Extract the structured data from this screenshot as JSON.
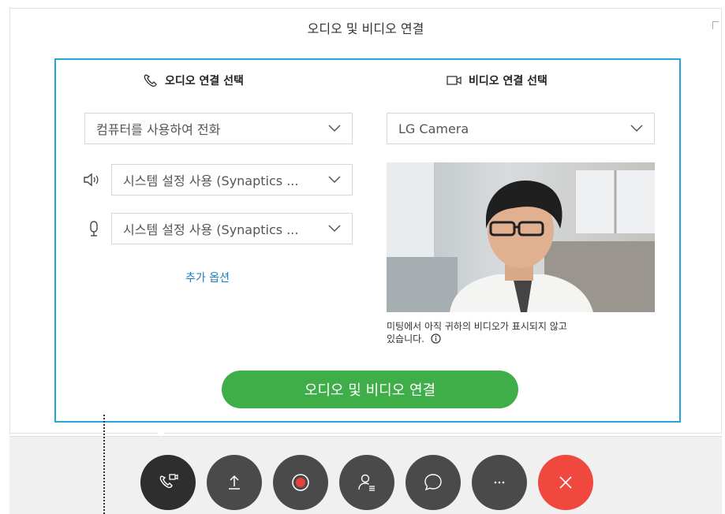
{
  "dialog": {
    "title": "오디오 및 비디오 연결"
  },
  "audio": {
    "heading": "오디오 연결 선택",
    "source": "컴퓨터를 사용하여 전화",
    "speaker": "시스템 설정 사용 (Synaptics ...",
    "microphone": "시스템 설정 사용 (Synaptics ...",
    "more_options": "추가 옵션"
  },
  "video": {
    "heading": "비디오 연결 선택",
    "camera": "LG Camera",
    "note_line1": "미팅에서 아직 귀하의 비디오가 표시되지 않고",
    "note_line2": "있습니다."
  },
  "connect_button": "오디오 및 비디오 연결",
  "colors": {
    "panel_border": "#26a6d6",
    "connect_green": "#3fae49",
    "link_blue": "#1b7cc2",
    "leave_red": "#f0473e",
    "toolbar_button": "#4a4a4a"
  },
  "toolbar": {
    "buttons": [
      {
        "icon": "phone-video-icon"
      },
      {
        "icon": "share-upload-icon"
      },
      {
        "icon": "record-icon"
      },
      {
        "icon": "participants-icon"
      },
      {
        "icon": "chat-icon"
      },
      {
        "icon": "more-icon"
      },
      {
        "icon": "close-icon"
      }
    ]
  }
}
